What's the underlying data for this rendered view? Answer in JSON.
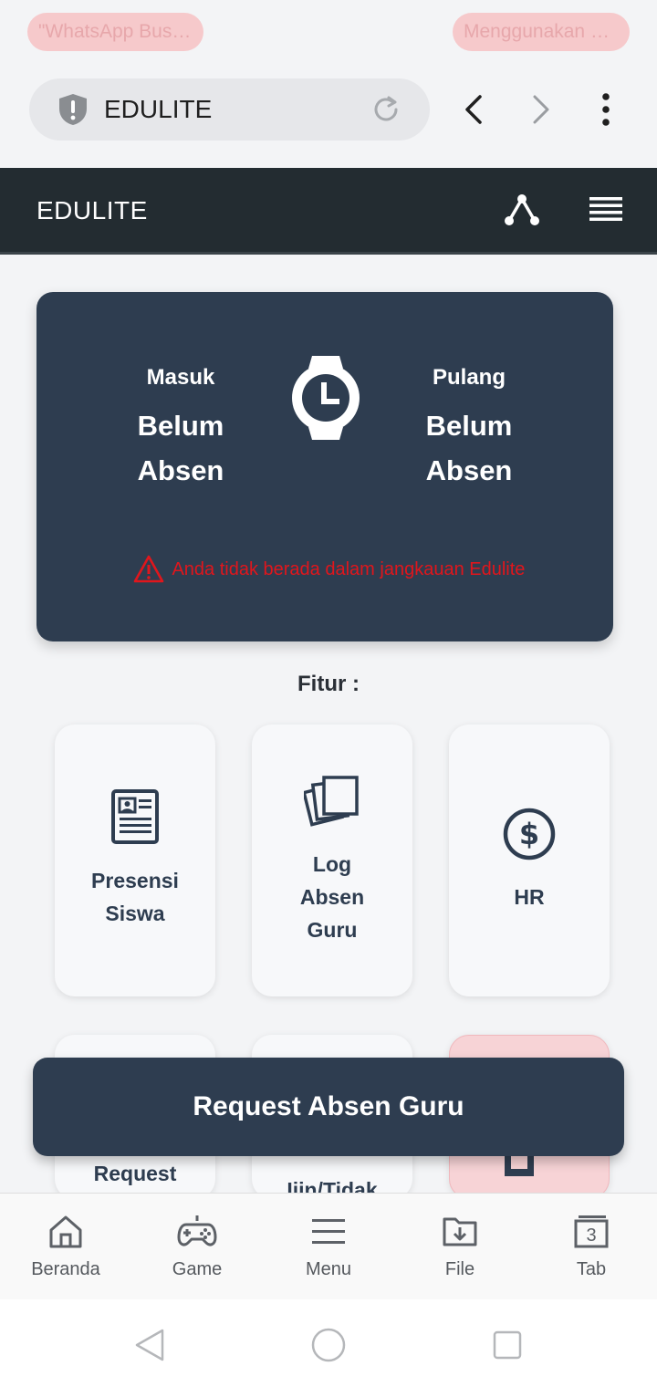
{
  "notifications": {
    "left": "\"WhatsApp Busin...",
    "right": "Menggunakan mi..."
  },
  "browser": {
    "url_text": "EDULITE"
  },
  "app": {
    "title": "EDULITE"
  },
  "attendance": {
    "in_label": "Masuk",
    "in_status_line1": "Belum",
    "in_status_line2": "Absen",
    "out_label": "Pulang",
    "out_status_line1": "Belum",
    "out_status_line2": "Absen",
    "warning": "Anda tidak berada dalam jangkauan Edulite"
  },
  "features": {
    "title": "Fitur :",
    "tiles": [
      {
        "label_line1": "Presensi",
        "label_line2": "Siswa"
      },
      {
        "label_line1": "Log",
        "label_line2": "Absen",
        "label_line3": "Guru"
      },
      {
        "label_line1": "HR"
      },
      {
        "label_line1": "Request"
      },
      {
        "label_line1": "Ijin/Tidak"
      }
    ]
  },
  "request_button": "Request Absen Guru",
  "bottom_nav": [
    {
      "label": "Beranda",
      "icon": "home-icon"
    },
    {
      "label": "Game",
      "icon": "gamepad-icon"
    },
    {
      "label": "Menu",
      "icon": "menu-icon"
    },
    {
      "label": "File",
      "icon": "folder-download-icon"
    },
    {
      "label": "Tab",
      "icon": "tabs-icon",
      "count": "3"
    }
  ],
  "colors": {
    "header_bg": "#232c31",
    "card_bg": "#2e3d50",
    "warning": "#e0161c"
  }
}
